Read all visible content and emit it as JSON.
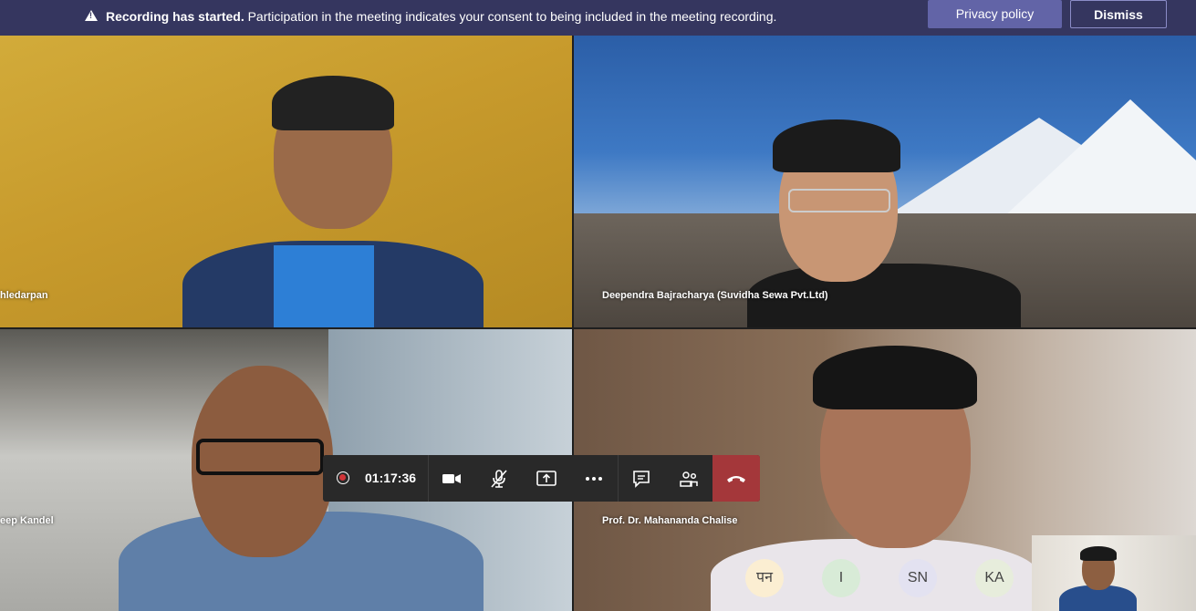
{
  "banner": {
    "title": "Recording has started.",
    "message": "Participation in the meeting indicates your consent to being included in the meeting recording.",
    "privacy_label": "Privacy policy",
    "dismiss_label": "Dismiss",
    "icon": "warning-icon"
  },
  "tiles": [
    {
      "name": "hledarpan"
    },
    {
      "name": "Deependra Bajracharya (Suvidha Sewa Pvt.Ltd)"
    },
    {
      "name": "eep Kandel"
    },
    {
      "name": "Prof. Dr. Mahananda Chalise"
    }
  ],
  "controls": {
    "timer": "01:17:36",
    "icons": [
      "record-icon",
      "camera-icon",
      "mic-off-icon",
      "share-screen-icon",
      "more-icon",
      "chat-icon",
      "participants-icon",
      "hang-up-icon"
    ]
  },
  "avatars": [
    {
      "initials": "पन",
      "color": "#fbeed2"
    },
    {
      "initials": "I",
      "color": "#d8ebd7"
    },
    {
      "initials": "SN",
      "color": "#e3e2f1"
    },
    {
      "initials": "KA",
      "color": "#e7eddc"
    }
  ],
  "colors": {
    "banner": "#35365f",
    "accent": "#6264a7",
    "hangup": "#a4373a"
  }
}
